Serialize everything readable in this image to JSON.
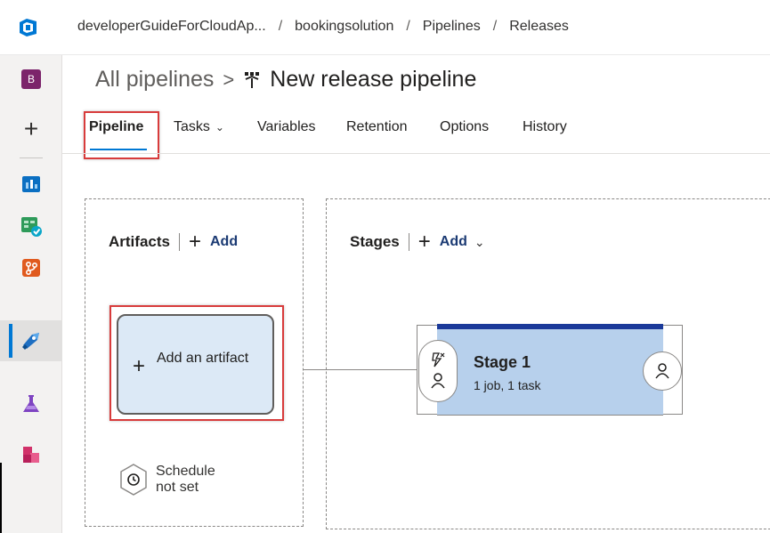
{
  "topbar": {
    "logo_icon": "azure-devops-logo-icon",
    "breadcrumbs": [
      "developerGuideForCloudAp...",
      "bookingsolution",
      "Pipelines",
      "Releases"
    ],
    "separator": "/"
  },
  "rail": {
    "avatar_letter": "B",
    "avatar_color": "#7c246b",
    "new_glyph": "+",
    "items": [
      "boards-icon",
      "test-plans-icon",
      "repos-icon",
      "pipelines-icon",
      "test-icon",
      "artifacts-icon"
    ],
    "selected": "pipelines-icon"
  },
  "header": {
    "root": "All pipelines",
    "chevron": ">",
    "pipeline_name": "New release pipeline"
  },
  "tabs": [
    {
      "label": "Pipeline",
      "active": true
    },
    {
      "label": "Tasks",
      "has_dropdown": true
    },
    {
      "label": "Variables"
    },
    {
      "label": "Retention"
    },
    {
      "label": "Options"
    },
    {
      "label": "History"
    }
  ],
  "artifacts": {
    "heading": "Artifacts",
    "add_label": "Add",
    "card_plus": "+",
    "card_label": "Add an artifact"
  },
  "schedule": {
    "label": "Schedule not set"
  },
  "stages": {
    "heading": "Stages",
    "add_label": "Add",
    "stage": {
      "name": "Stage 1",
      "summary": "1 job, 1 task"
    }
  },
  "colors": {
    "accent": "#0078d4",
    "highlight_box": "#d83b3b",
    "stage_fill": "#b7d0ec",
    "stage_top": "#1b3a9a",
    "artifact_fill": "#dce9f6"
  }
}
